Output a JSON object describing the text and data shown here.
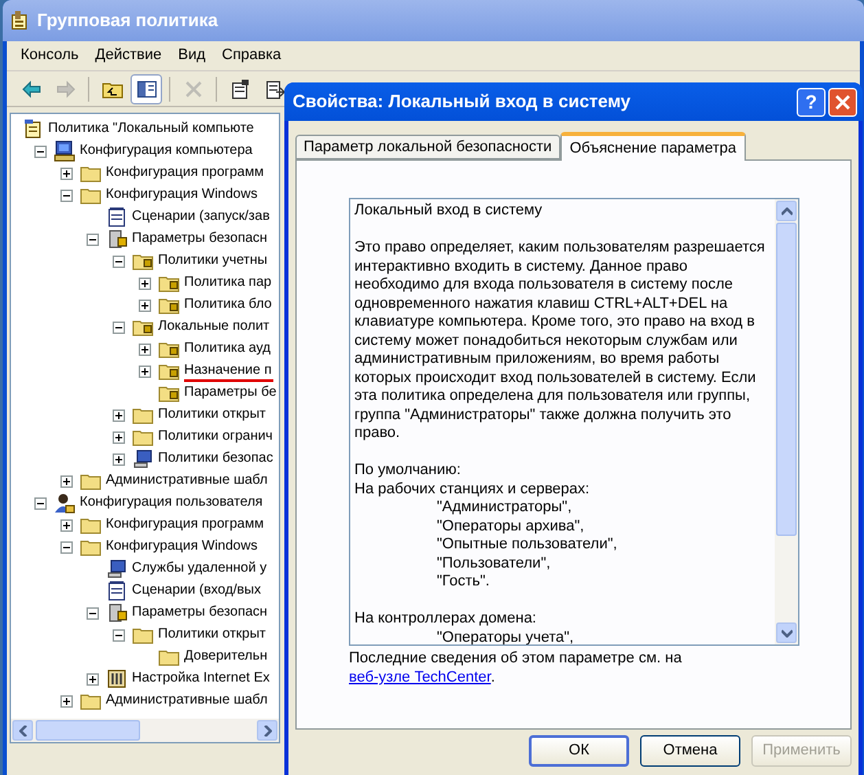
{
  "main_window": {
    "title": "Групповая политика"
  },
  "menu": [
    "Консоль",
    "Действие",
    "Вид",
    "Справка"
  ],
  "toolbar": [
    {
      "kind": "back",
      "disabled": false,
      "pressed": false
    },
    {
      "kind": "forward",
      "disabled": true,
      "pressed": false
    },
    {
      "kind": "up",
      "disabled": false,
      "pressed": false
    },
    {
      "kind": "tree-toggle",
      "disabled": false,
      "pressed": true
    },
    {
      "kind": "delete",
      "disabled": true,
      "pressed": false
    },
    {
      "kind": "properties",
      "disabled": false,
      "pressed": false
    },
    {
      "kind": "export",
      "disabled": false,
      "pressed": false
    }
  ],
  "tree": [
    {
      "label": "Политика \"Локальный компьюте",
      "kind": "policy",
      "marked": false,
      "children": [
        {
          "label": "Конфигурация компьютера",
          "kind": "computer",
          "expanded": true,
          "marked": false,
          "children": [
            {
              "label": "Конфигурация программ",
              "kind": "folder",
              "expanded": false,
              "marked": false
            },
            {
              "label": "Конфигурация Windows",
              "kind": "folder",
              "expanded": true,
              "marked": false,
              "children": [
                {
                  "label": "Сценарии (запуск/зав",
                  "kind": "script",
                  "marked": false
                },
                {
                  "label": "Параметры безопасн",
                  "kind": "secure",
                  "expanded": true,
                  "marked": false,
                  "children": [
                    {
                      "label": "Политики учетны",
                      "kind": "lockfolder",
                      "expanded": true,
                      "marked": false,
                      "children": [
                        {
                          "label": "Политика пар",
                          "kind": "lockfolder",
                          "expanded": false,
                          "marked": false
                        },
                        {
                          "label": "Политика бло",
                          "kind": "lockfolder",
                          "expanded": false,
                          "marked": false
                        }
                      ]
                    },
                    {
                      "label": "Локальные полит",
                      "kind": "lockfolder",
                      "expanded": true,
                      "marked": false,
                      "children": [
                        {
                          "label": "Политика ауд",
                          "kind": "lockfolder",
                          "expanded": false,
                          "marked": false
                        },
                        {
                          "label": "Назначение п",
                          "kind": "lockfolder",
                          "expanded": false,
                          "marked": true
                        },
                        {
                          "label": "Параметры бе",
                          "kind": "lockfolder",
                          "marked": false
                        }
                      ]
                    },
                    {
                      "label": "Политики открыт",
                      "kind": "folder",
                      "expanded": false,
                      "marked": false
                    },
                    {
                      "label": "Политики огранич",
                      "kind": "folder",
                      "expanded": false,
                      "marked": false
                    },
                    {
                      "label": "Политики безопас",
                      "kind": "network",
                      "expanded": false,
                      "marked": false
                    }
                  ]
                }
              ]
            },
            {
              "label": "Административные шабл",
              "kind": "folder",
              "expanded": false,
              "marked": false
            }
          ]
        },
        {
          "label": "Конфигурация пользователя",
          "kind": "user",
          "expanded": true,
          "marked": false,
          "children": [
            {
              "label": "Конфигурация программ",
              "kind": "folder",
              "expanded": false,
              "marked": false
            },
            {
              "label": "Конфигурация Windows",
              "kind": "folder",
              "expanded": true,
              "marked": false,
              "children": [
                {
                  "label": "Службы удаленной у",
                  "kind": "network",
                  "marked": false
                },
                {
                  "label": "Сценарии (вход/вых",
                  "kind": "script",
                  "marked": false
                },
                {
                  "label": "Параметры безопасн",
                  "kind": "secure",
                  "expanded": true,
                  "marked": false,
                  "children": [
                    {
                      "label": "Политики открыт",
                      "kind": "folder",
                      "expanded": true,
                      "marked": false,
                      "children": [
                        {
                          "label": "Доверительн",
                          "kind": "folder",
                          "marked": false
                        }
                      ]
                    }
                  ]
                },
                {
                  "label": "Настройка Internet Ex",
                  "kind": "tools",
                  "expanded": false,
                  "marked": false
                }
              ]
            },
            {
              "label": "Административные шабл",
              "kind": "folder",
              "expanded": false,
              "marked": false
            }
          ]
        }
      ]
    }
  ],
  "dialog": {
    "title": "Свойства: Локальный вход в систему",
    "help_button": "?",
    "tabs": [
      {
        "label": "Параметр локальной безопасности",
        "selected": false
      },
      {
        "label": "Объяснение параметра",
        "selected": true
      }
    ],
    "explanation": [
      {
        "kind": "line",
        "text": "Локальный вход в систему"
      },
      {
        "kind": "spacer"
      },
      {
        "kind": "line",
        "text": "Это право определяет, каким пользователям разрешается интерактивно входить в систему. Данное право необходимо для входа пользователя в систему после одновременного нажатия клавиш CTRL+ALT+DEL на клавиатуре компьютера. Кроме того, это право на вход в систему может понадобиться некоторым службам или административным приложениям, во время работы которых происходит вход пользователей в систему. Если эта политика определена для пользователя или группы, группа \"Администраторы\" также должна получить это право."
      },
      {
        "kind": "spacer"
      },
      {
        "kind": "line",
        "text": "По умолчанию:"
      },
      {
        "kind": "line",
        "text": "На рабочих станциях и серверах:"
      },
      {
        "kind": "indented",
        "text": "\"Администраторы\","
      },
      {
        "kind": "indented",
        "text": "\"Операторы архива\","
      },
      {
        "kind": "indented",
        "text": "\"Опытные пользователи\","
      },
      {
        "kind": "indented",
        "text": "\"Пользователи\","
      },
      {
        "kind": "indented",
        "text": "\"Гость\"."
      },
      {
        "kind": "spacer"
      },
      {
        "kind": "line",
        "text": "На контроллерах домена:"
      },
      {
        "kind": "indented",
        "text": "\"Операторы учета\","
      }
    ],
    "footer": {
      "text": "Последние сведения об этом параметре см. на",
      "link": "веб-узле TechCenter",
      "after": "."
    },
    "buttons": [
      {
        "label": "ОК",
        "default": true,
        "disabled": false
      },
      {
        "label": "Отмена",
        "default": false,
        "disabled": false
      },
      {
        "label": "Применить",
        "default": false,
        "disabled": true
      }
    ]
  }
}
